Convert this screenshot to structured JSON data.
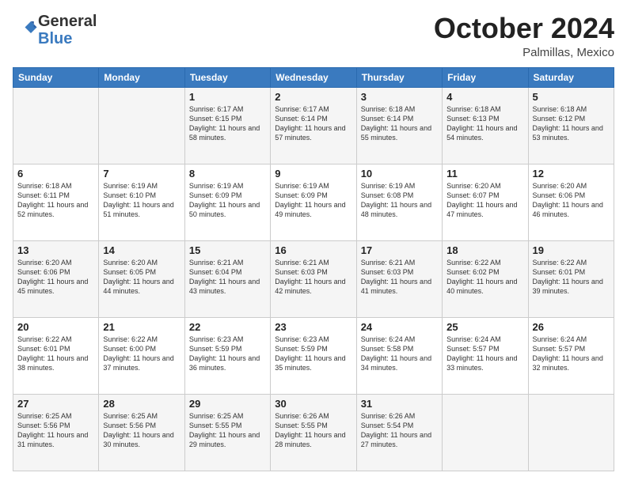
{
  "header": {
    "logo": {
      "general": "General",
      "blue": "Blue"
    },
    "month": "October 2024",
    "location": "Palmillas, Mexico"
  },
  "days_of_week": [
    "Sunday",
    "Monday",
    "Tuesday",
    "Wednesday",
    "Thursday",
    "Friday",
    "Saturday"
  ],
  "weeks": [
    [
      {
        "day": "",
        "info": ""
      },
      {
        "day": "",
        "info": ""
      },
      {
        "day": "1",
        "info": "Sunrise: 6:17 AM\nSunset: 6:15 PM\nDaylight: 11 hours and 58 minutes."
      },
      {
        "day": "2",
        "info": "Sunrise: 6:17 AM\nSunset: 6:14 PM\nDaylight: 11 hours and 57 minutes."
      },
      {
        "day": "3",
        "info": "Sunrise: 6:18 AM\nSunset: 6:14 PM\nDaylight: 11 hours and 55 minutes."
      },
      {
        "day": "4",
        "info": "Sunrise: 6:18 AM\nSunset: 6:13 PM\nDaylight: 11 hours and 54 minutes."
      },
      {
        "day": "5",
        "info": "Sunrise: 6:18 AM\nSunset: 6:12 PM\nDaylight: 11 hours and 53 minutes."
      }
    ],
    [
      {
        "day": "6",
        "info": "Sunrise: 6:18 AM\nSunset: 6:11 PM\nDaylight: 11 hours and 52 minutes."
      },
      {
        "day": "7",
        "info": "Sunrise: 6:19 AM\nSunset: 6:10 PM\nDaylight: 11 hours and 51 minutes."
      },
      {
        "day": "8",
        "info": "Sunrise: 6:19 AM\nSunset: 6:09 PM\nDaylight: 11 hours and 50 minutes."
      },
      {
        "day": "9",
        "info": "Sunrise: 6:19 AM\nSunset: 6:09 PM\nDaylight: 11 hours and 49 minutes."
      },
      {
        "day": "10",
        "info": "Sunrise: 6:19 AM\nSunset: 6:08 PM\nDaylight: 11 hours and 48 minutes."
      },
      {
        "day": "11",
        "info": "Sunrise: 6:20 AM\nSunset: 6:07 PM\nDaylight: 11 hours and 47 minutes."
      },
      {
        "day": "12",
        "info": "Sunrise: 6:20 AM\nSunset: 6:06 PM\nDaylight: 11 hours and 46 minutes."
      }
    ],
    [
      {
        "day": "13",
        "info": "Sunrise: 6:20 AM\nSunset: 6:06 PM\nDaylight: 11 hours and 45 minutes."
      },
      {
        "day": "14",
        "info": "Sunrise: 6:20 AM\nSunset: 6:05 PM\nDaylight: 11 hours and 44 minutes."
      },
      {
        "day": "15",
        "info": "Sunrise: 6:21 AM\nSunset: 6:04 PM\nDaylight: 11 hours and 43 minutes."
      },
      {
        "day": "16",
        "info": "Sunrise: 6:21 AM\nSunset: 6:03 PM\nDaylight: 11 hours and 42 minutes."
      },
      {
        "day": "17",
        "info": "Sunrise: 6:21 AM\nSunset: 6:03 PM\nDaylight: 11 hours and 41 minutes."
      },
      {
        "day": "18",
        "info": "Sunrise: 6:22 AM\nSunset: 6:02 PM\nDaylight: 11 hours and 40 minutes."
      },
      {
        "day": "19",
        "info": "Sunrise: 6:22 AM\nSunset: 6:01 PM\nDaylight: 11 hours and 39 minutes."
      }
    ],
    [
      {
        "day": "20",
        "info": "Sunrise: 6:22 AM\nSunset: 6:01 PM\nDaylight: 11 hours and 38 minutes."
      },
      {
        "day": "21",
        "info": "Sunrise: 6:22 AM\nSunset: 6:00 PM\nDaylight: 11 hours and 37 minutes."
      },
      {
        "day": "22",
        "info": "Sunrise: 6:23 AM\nSunset: 5:59 PM\nDaylight: 11 hours and 36 minutes."
      },
      {
        "day": "23",
        "info": "Sunrise: 6:23 AM\nSunset: 5:59 PM\nDaylight: 11 hours and 35 minutes."
      },
      {
        "day": "24",
        "info": "Sunrise: 6:24 AM\nSunset: 5:58 PM\nDaylight: 11 hours and 34 minutes."
      },
      {
        "day": "25",
        "info": "Sunrise: 6:24 AM\nSunset: 5:57 PM\nDaylight: 11 hours and 33 minutes."
      },
      {
        "day": "26",
        "info": "Sunrise: 6:24 AM\nSunset: 5:57 PM\nDaylight: 11 hours and 32 minutes."
      }
    ],
    [
      {
        "day": "27",
        "info": "Sunrise: 6:25 AM\nSunset: 5:56 PM\nDaylight: 11 hours and 31 minutes."
      },
      {
        "day": "28",
        "info": "Sunrise: 6:25 AM\nSunset: 5:56 PM\nDaylight: 11 hours and 30 minutes."
      },
      {
        "day": "29",
        "info": "Sunrise: 6:25 AM\nSunset: 5:55 PM\nDaylight: 11 hours and 29 minutes."
      },
      {
        "day": "30",
        "info": "Sunrise: 6:26 AM\nSunset: 5:55 PM\nDaylight: 11 hours and 28 minutes."
      },
      {
        "day": "31",
        "info": "Sunrise: 6:26 AM\nSunset: 5:54 PM\nDaylight: 11 hours and 27 minutes."
      },
      {
        "day": "",
        "info": ""
      },
      {
        "day": "",
        "info": ""
      }
    ]
  ]
}
